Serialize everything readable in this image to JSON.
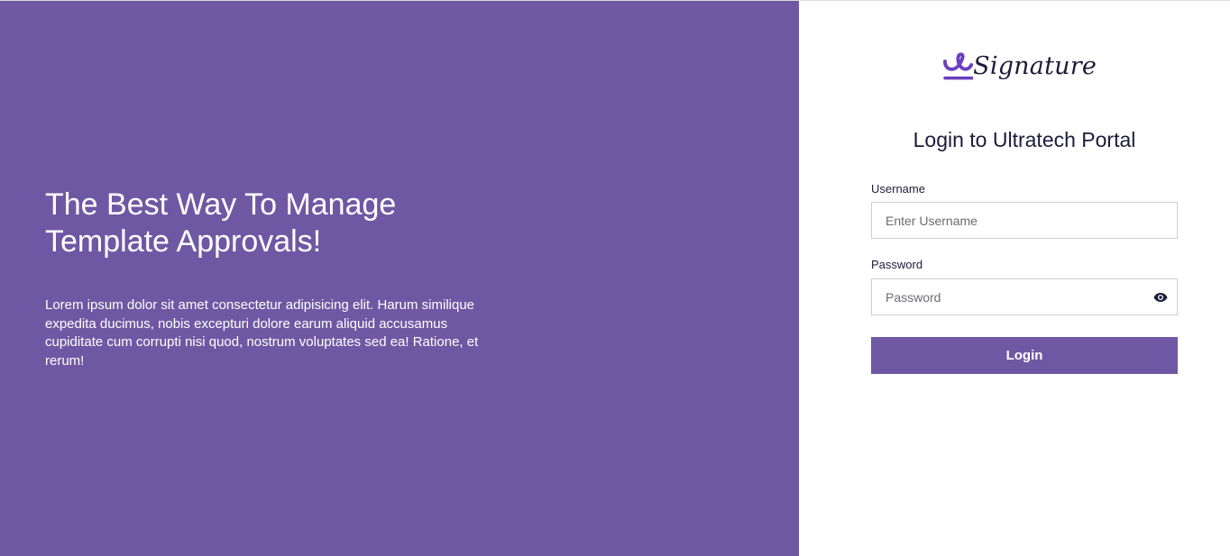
{
  "hero": {
    "title": "The Best Way To Manage Template Approvals!",
    "description": "Lorem ipsum dolor sit amet consectetur adipisicing elit. Harum similique expedita ducimus, nobis excepturi dolore earum aliquid accusamus cupiditate cum corrupti nisi quod, nostrum voluptates sed ea! Ratione, et rerum!"
  },
  "brand": {
    "logo_text": "Signature",
    "logo_icon": "signature-logo-icon"
  },
  "login": {
    "title": "Login to Ultratech Portal",
    "username_label": "Username",
    "username_placeholder": "Enter Username",
    "username_value": "",
    "password_label": "Password",
    "password_placeholder": "Password",
    "password_value": "",
    "show_password_icon": "eye-icon",
    "button_label": "Login"
  },
  "colors": {
    "primary": "#6f58a3",
    "text_dark": "#1d1b3a",
    "logo_accent": "#6a3fc0"
  }
}
